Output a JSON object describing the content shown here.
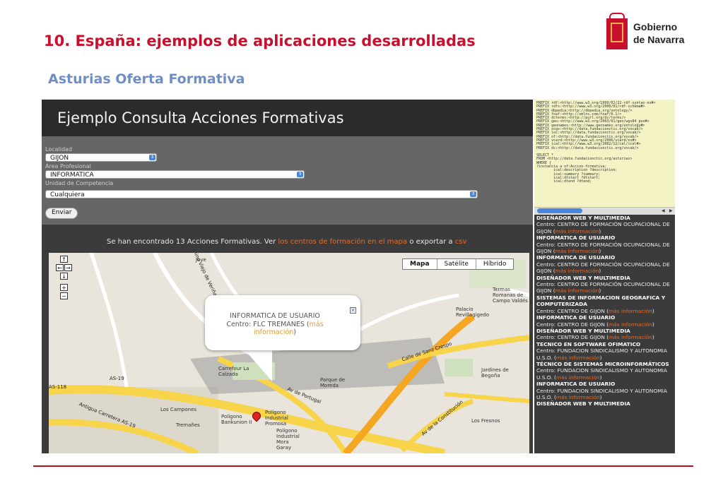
{
  "slide": {
    "title": "10. España: ejemplos de aplicaciones desarrolladas",
    "subtitle": "Asturias Oferta Formativa",
    "logo": {
      "line1": "Gobierno",
      "line2": "de Navarra"
    }
  },
  "app": {
    "title": "Ejemplo Consulta Acciones Formativas",
    "form": {
      "localidad_label": "Localidad",
      "localidad_value": "GIJON",
      "area_label": "Área Profesional",
      "area_value": "INFORMATICA",
      "unidad_label": "Unidad de Competencia",
      "unidad_value": "Cualquiera",
      "send_label": "Enviar"
    },
    "results": {
      "prefix": "Se han encontrado 13 Acciones Formativas. Ver ",
      "link1": "los centros de formación en el mapa",
      "middle": " o exportar a ",
      "link2": "csv"
    },
    "map": {
      "types": [
        "Mapa",
        "Satélite",
        "Híbrido"
      ],
      "active_type": "Mapa",
      "controls": {
        "up": "↑",
        "left": "←",
        "right": "→",
        "down": "↓",
        "zoom_in": "+",
        "zoom_out": "−"
      },
      "labels": [
        "Jove",
        "Carrefour La Calzada",
        "Los Campones",
        "Tremañes",
        "Polígono Bankunion II",
        "Polígono Industrial Promosa",
        "Polígono Industrial Mora Garay",
        "Termas Romanas de Campo Valdés",
        "Palacio Revillagigedo",
        "Jardines de Begoña",
        "Los Fresnos",
        "Parque de Moreda",
        "Calle de Sanz Crespo",
        "Av de Portugal",
        "Av de la Constitución",
        "Antigua Carretera AS-19",
        "AS-19",
        "AS-118",
        "Camino Viejo de Veriña"
      ],
      "popup": {
        "title": "INFORMATICA DE USUARIO",
        "centre_prefix": "Centro: FLC TREMANES (",
        "centre_link": "más información",
        "centre_suffix": ")"
      }
    }
  },
  "query": {
    "lines": [
      "PREFIX rdf:<http://www.w3.org/1999/02/22-rdf-syntax-ns#>",
      "PREFIX rdfs:<http://www.w3.org/2000/01/rdf-schema#>",
      "PREFIX dbpedia:<http://dbpedia.org/ontology/>",
      "PREFIX foaf:<http://xmlns.com/foaf/0.1/>",
      "PREFIX dcterms:<http://purl.org/dc/terms/>",
      "PREFIX geo:<http://www.w3.org/2003/01/geo/wgs84_pos#>",
      "PREFIX geonames:<http://www.geonames.org/ontology#>",
      "PREFIX ocgs:<http://data.fundacionctic.org/vocab/>",
      "PREFIX loc:<http://data.fundacionctic.org/vocab/>",
      "PREFIX of:<http://data.fundacionctic.org/vocab/>",
      "PREFIX vcard:<http://www.w3.org/2006/vcard/ns#>",
      "PREFIX ical:<http://www.w3.org/2002/12/cal/ical#>",
      "PREFIX dc:<http://data.fundacionctic.org/vocab/>",
      "",
      "SELECT *",
      "FROM <http://data.fundacionctic.org/asturias>",
      "WHERE {",
      "?instancia a of:Accion-formativa;",
      "        ical:description ?description;",
      "        ical:summary ?summary;",
      "        ical:dtstart ?dtstart;",
      "        ical:dtend ?dtend;"
    ]
  },
  "sidebar": {
    "items": [
      {
        "title": "DISEÑADOR WEB Y MULTIMEDIA",
        "centre": "Centro: CENTRO DE FORMACIÓN OCUPACIONAL DE GIJON (",
        "link": "más información",
        "close": ")"
      },
      {
        "title": "INFORMATICA DE USUARIO",
        "centre": "Centro: CENTRO DE FORMACIÓN OCUPACIONAL DE GIJON (",
        "link": "más información",
        "close": ")"
      },
      {
        "title": "INFORMATICA DE USUARIO",
        "centre": "Centro: CENTRO DE FORMACIÓN OCUPACIONAL DE GIJON (",
        "link": "más información",
        "close": ")"
      },
      {
        "title": "DISEÑADOR WEB Y MULTIMEDIA",
        "centre": "Centro: CENTRO DE FORMACIÓN OCUPACIONAL DE GIJON (",
        "link": "más información",
        "close": ")"
      },
      {
        "title": "SISTEMAS DE INFORMACION GEOGRAFICA Y COMPUTERIZADA",
        "centre": "Centro: CENTRO DE GIJON (",
        "link": "más información",
        "close": ")"
      },
      {
        "title": "INFORMATICA DE USUARIO",
        "centre": "Centro: CENTRO DE GIJON (",
        "link": "más información",
        "close": ")"
      },
      {
        "title": "DISEÑADOR WEB Y MULTIMEDIA",
        "centre": "Centro: CENTRO DE GIJON (",
        "link": "más información",
        "close": ")"
      },
      {
        "title": "TECNICO EN SOFTWARE OFIMATICO",
        "centre": "Centro: FUNDACION SINDICALISMO Y AUTONOMIA U.S.O. (",
        "link": "más información",
        "close": ")"
      },
      {
        "title": "TÉCNICO DE SISTEMAS MICROINFORMÁTICOS",
        "centre": "Centro: FUNDACION SINDICALISMO Y AUTONOMIA U.S.O. (",
        "link": "más información",
        "close": ")"
      },
      {
        "title": "INFORMATICA DE USUARIO",
        "centre": "Centro: FUNDACION SINDICALISMO Y AUTONOMIA U.S.O. (",
        "link": "más información",
        "close": ")"
      },
      {
        "title": "DISEÑADOR WEB Y MULTIMEDIA",
        "centre": "",
        "link": "",
        "close": ""
      }
    ]
  },
  "colors": {
    "title_red": "#c8102e",
    "subtitle_blue": "#6f8fc4",
    "link_orange": "#e46b2c",
    "map_road_yellow": "#f7d44a"
  }
}
